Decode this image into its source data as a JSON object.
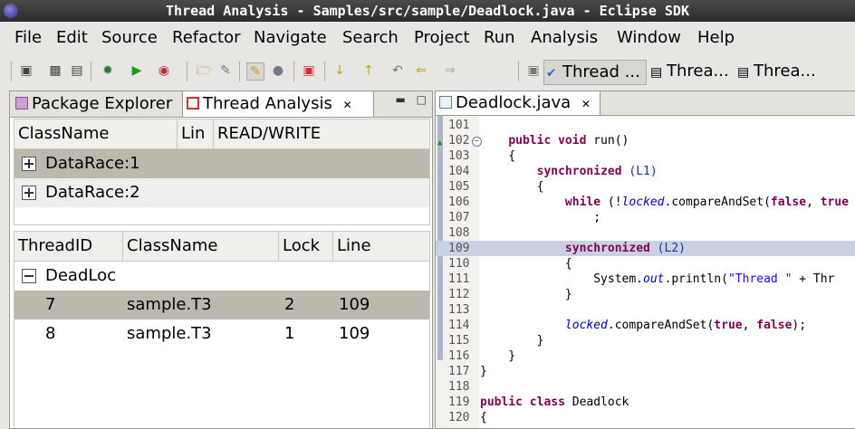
{
  "window": {
    "title": "Thread Analysis - Samples/src/sample/Deadlock.java - Eclipse SDK"
  },
  "menu": [
    "File",
    "Edit",
    "Source",
    "Refactor",
    "Navigate",
    "Search",
    "Project",
    "Run",
    "Analysis",
    "Window",
    "Help"
  ],
  "perspectives": [
    "Thread ...",
    "Threa...",
    "Threa..."
  ],
  "left_tabs": {
    "package_explorer": "Package Explorer",
    "thread_analysis": "Thread Analysis"
  },
  "race_table": {
    "headers": [
      "ClassName",
      "Lin",
      "READ/WRITE"
    ],
    "rows": [
      "DataRace:1",
      "DataRace:2"
    ]
  },
  "deadlock_table": {
    "headers": [
      "ThreadID",
      "ClassName",
      "Lock",
      "Line"
    ],
    "group": "DeadLoc",
    "rows": [
      {
        "id": "7",
        "class": "sample.T3",
        "lock": "2",
        "line": "109"
      },
      {
        "id": "8",
        "class": "sample.T3",
        "lock": "1",
        "line": "109"
      }
    ]
  },
  "editor": {
    "tab": "Deadlock.java",
    "lines": [
      {
        "n": "101",
        "html": ""
      },
      {
        "n": "102",
        "html": "    <span class=\"kw\">public void</span> run()"
      },
      {
        "n": "103",
        "html": "    {"
      },
      {
        "n": "104",
        "html": "        <span class=\"kw\">synchronized</span> <span class=\"lk\">(L1)</span>"
      },
      {
        "n": "105",
        "html": "        {"
      },
      {
        "n": "106",
        "html": "            <span class=\"kw\">while</span> (!<span class=\"it\">locked</span>.compareAndSet(<span class=\"kw\">false</span>, <span class=\"kw\">true</span>"
      },
      {
        "n": "107",
        "html": "                ;"
      },
      {
        "n": "108",
        "html": ""
      },
      {
        "n": "109",
        "html": "            <span class=\"kw\">synchronized</span> <span class=\"lk\">(L2)</span>"
      },
      {
        "n": "110",
        "html": "            {"
      },
      {
        "n": "111",
        "html": "                System.<span class=\"it\">out</span>.println(<span class=\"st\">\"Thread \"</span> + Thr"
      },
      {
        "n": "112",
        "html": "            }"
      },
      {
        "n": "113",
        "html": ""
      },
      {
        "n": "114",
        "html": "            <span class=\"it\">locked</span>.compareAndSet(<span class=\"kw\">true</span>, <span class=\"kw\">false</span>);"
      },
      {
        "n": "115",
        "html": "        }"
      },
      {
        "n": "116",
        "html": "    }"
      },
      {
        "n": "117",
        "html": "}"
      },
      {
        "n": "118",
        "html": ""
      },
      {
        "n": "119",
        "html": "<span class=\"kw\">public class</span> Deadlock"
      },
      {
        "n": "120",
        "html": "{"
      }
    ]
  }
}
